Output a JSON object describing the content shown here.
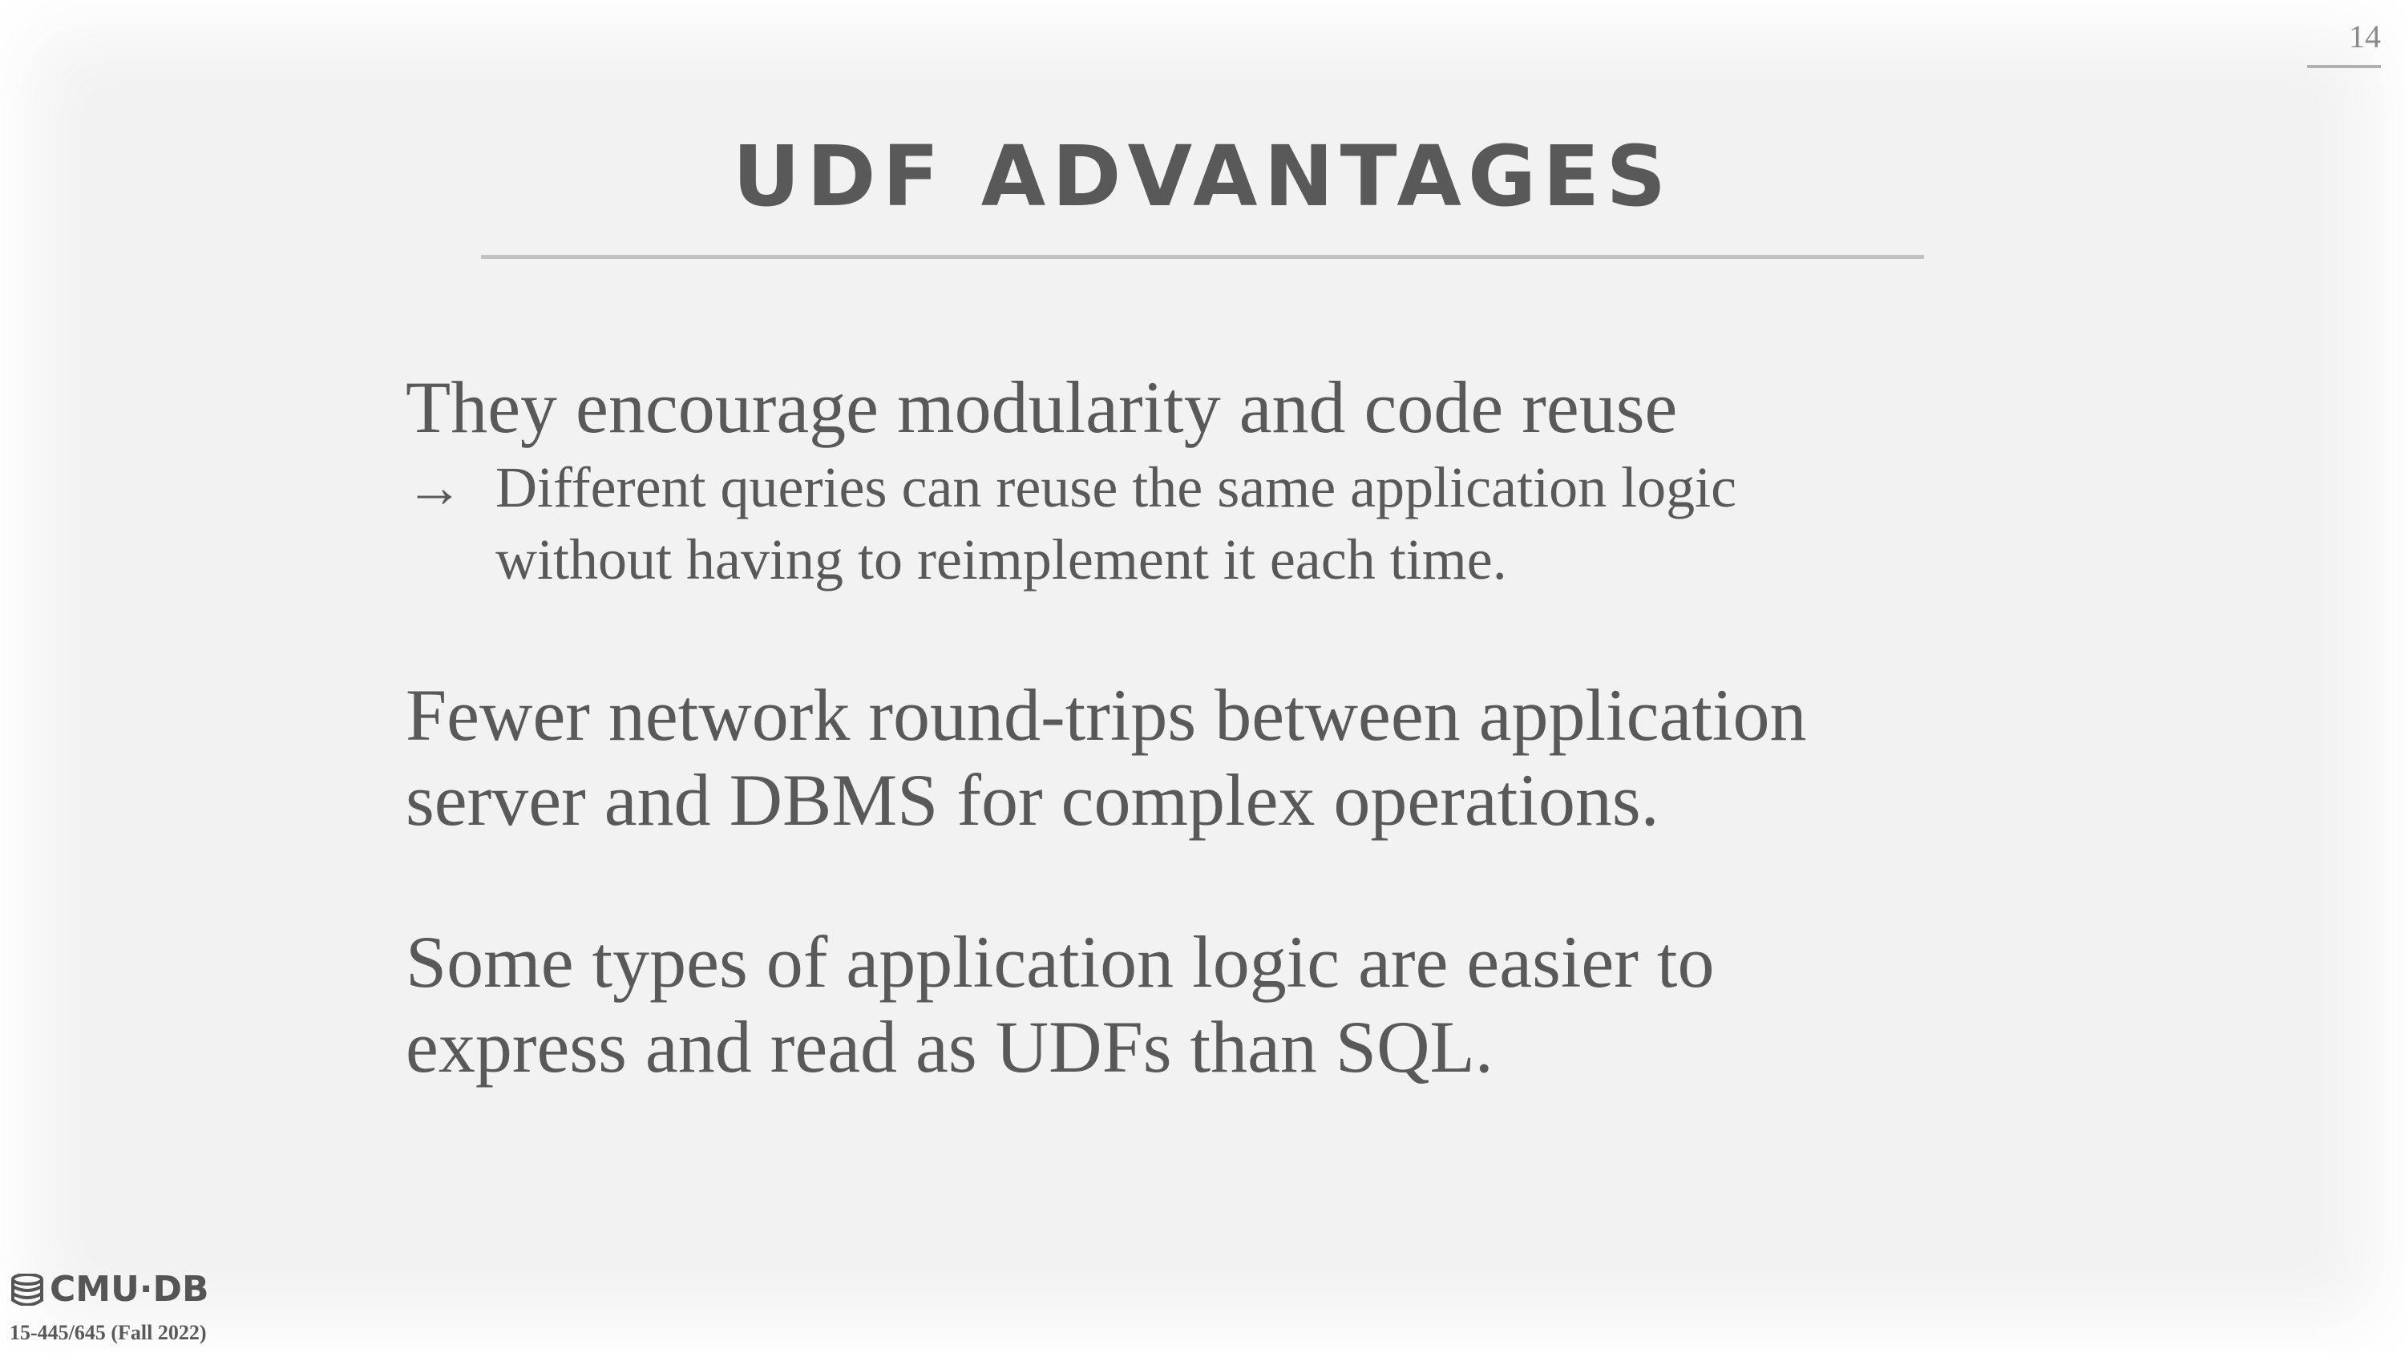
{
  "slide": {
    "page_number": "14",
    "title": "UDF ADVANTAGES",
    "bullets": [
      {
        "text": "They encourage modularity and code reuse",
        "sub": [
          {
            "arrow": "→",
            "lines": [
              "Different queries can reuse the same application logic",
              "without having to reimplement it each time."
            ]
          }
        ]
      },
      {
        "lines": [
          "Fewer network round-trips between application",
          "server and DBMS for complex operations."
        ]
      },
      {
        "lines": [
          "Some types of application logic are easier to",
          "express and read as UDFs than SQL."
        ]
      }
    ]
  },
  "footer": {
    "logo_text": "CMU·DB",
    "logo_icon": "database-icon",
    "course": "15-445/645 (Fall 2022)"
  },
  "colors": {
    "text": "#595959",
    "background": "#f2f2f2",
    "rule": "#c2c2c2"
  }
}
